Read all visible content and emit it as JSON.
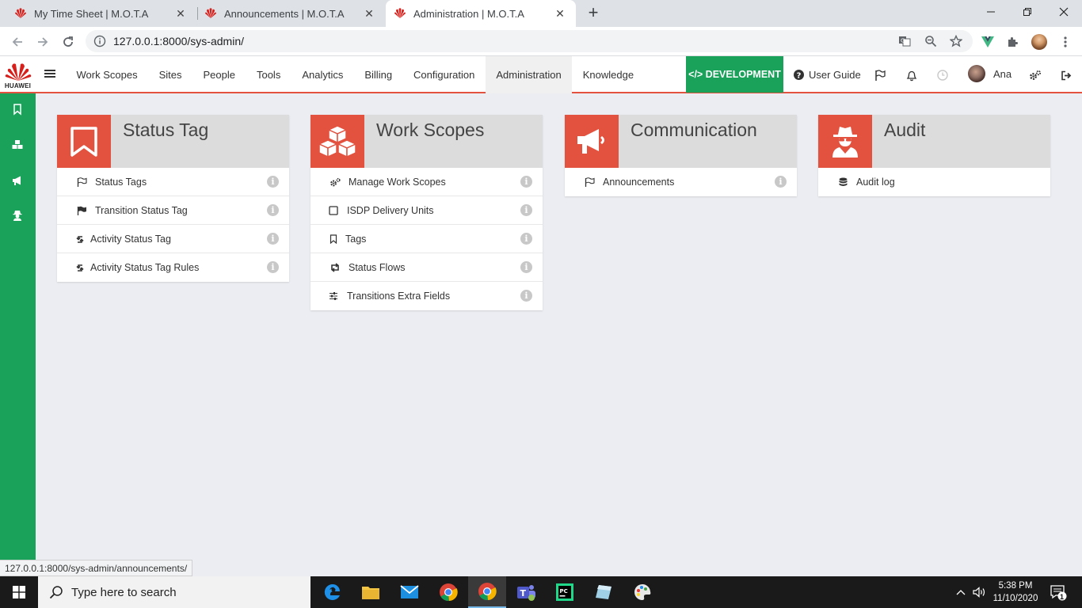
{
  "browser": {
    "tabs": [
      {
        "title": "My Time Sheet | M.O.T.A",
        "active": false
      },
      {
        "title": "Announcements | M.O.T.A",
        "active": false
      },
      {
        "title": "Administration | M.O.T.A",
        "active": true
      }
    ],
    "url": "127.0.0.1:8000/sys-admin/",
    "status_url": "127.0.0.1:8000/sys-admin/announcements/"
  },
  "app": {
    "logo_text": "HUAWEI",
    "menu": [
      "Work Scopes",
      "Sites",
      "People",
      "Tools",
      "Analytics",
      "Billing",
      "Configuration",
      "Administration",
      "Knowledge"
    ],
    "active_menu": "Administration",
    "dev_label": "</> DEVELOPMENT",
    "guide_label": "User Guide",
    "user_name": "Ana",
    "accent_color": "#e2523f",
    "green_color": "#1aa25b"
  },
  "cards": [
    {
      "title": "Status Tag",
      "icon": "bookmark-icon",
      "items": [
        {
          "label": "Status Tags",
          "icon": "flag-outline-icon"
        },
        {
          "label": "Transition Status Tag",
          "icon": "flag-solid-icon"
        },
        {
          "label": "Activity Status Tag",
          "icon": "sync-icon"
        },
        {
          "label": "Activity Status Tag Rules",
          "icon": "sync-icon"
        }
      ]
    },
    {
      "title": "Work Scopes",
      "icon": "cubes-icon",
      "items": [
        {
          "label": "Manage Work Scopes",
          "icon": "cogs-icon"
        },
        {
          "label": "ISDP Delivery Units",
          "icon": "square-icon"
        },
        {
          "label": "Tags",
          "icon": "bookmark-outline-icon"
        },
        {
          "label": "Status Flows",
          "icon": "retweet-icon"
        },
        {
          "label": "Transitions Extra Fields",
          "icon": "sliders-icon"
        }
      ]
    },
    {
      "title": "Communication",
      "icon": "megaphone-icon",
      "items": [
        {
          "label": "Announcements",
          "icon": "flag-outline-icon"
        }
      ]
    },
    {
      "title": "Audit",
      "icon": "user-secret-icon",
      "items": [
        {
          "label": "Audit log",
          "icon": "database-icon"
        }
      ]
    }
  ],
  "taskbar": {
    "search_placeholder": "Type here to search",
    "time": "5:38 PM",
    "date": "11/10/2020",
    "notifications": "1"
  }
}
